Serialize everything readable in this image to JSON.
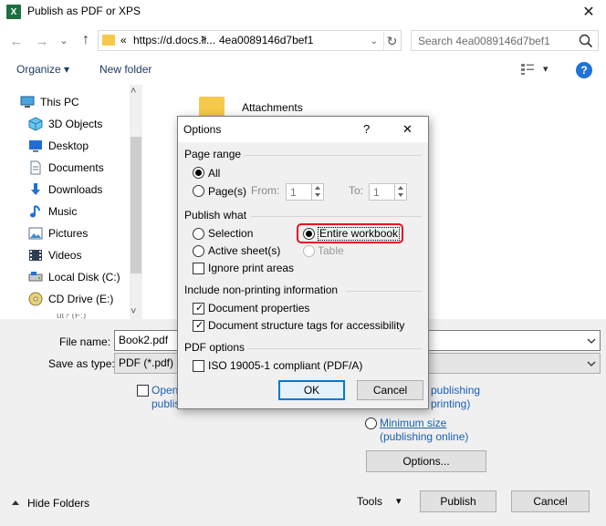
{
  "window": {
    "title": "Publish as PDF or XPS",
    "app_icon_letter": "X",
    "close_glyph": "✕"
  },
  "address": {
    "back_glyph": "←",
    "forward_glyph": "→",
    "history_glyph": "⌄",
    "up_glyph": "↑",
    "prefix": "«",
    "path": "https://d.docs.li...",
    "sep": ">",
    "crumb": "4ea0089146d7bef1",
    "dropdown_glyph": "⌄",
    "refresh_glyph": "↻"
  },
  "search": {
    "placeholder": "Search 4ea0089146d7bef1"
  },
  "toolbar": {
    "organize_label": "Organize ▾",
    "new_folder_label": "New folder",
    "view_dd_glyph": "▾",
    "help_label": "?"
  },
  "sidebar": {
    "items": [
      {
        "label": "This PC",
        "icon": "computer-icon"
      },
      {
        "label": "3D Objects",
        "icon": "cube-icon"
      },
      {
        "label": "Desktop",
        "icon": "desktop-icon"
      },
      {
        "label": "Documents",
        "icon": "document-icon"
      },
      {
        "label": "Downloads",
        "icon": "download-icon"
      },
      {
        "label": "Music",
        "icon": "music-icon"
      },
      {
        "label": "Pictures",
        "icon": "picture-icon"
      },
      {
        "label": "Videos",
        "icon": "video-icon"
      },
      {
        "label": "Local Disk (C:)",
        "icon": "drive-icon"
      },
      {
        "label": "CD Drive (E:)",
        "icon": "cd-icon"
      }
    ],
    "scroll_up": "˄",
    "scroll_down": "˅",
    "cut_item": "ut? (F:)"
  },
  "files": {
    "items": [
      {
        "label": "Attachments",
        "icon": "folder-icon"
      }
    ]
  },
  "form": {
    "file_name_label": "File name:",
    "file_name_value": "Book2.pdf",
    "save_type_label": "Save as type:",
    "save_type_value": "PDF (*.pdf)",
    "open_label_1": "Open",
    "open_label_2": "publis",
    "opt_std_1": "publishing",
    "opt_std_2": "printing)",
    "min_size_1": "Minimum size",
    "min_size_2": "(publishing online)",
    "options_button": "Options...",
    "hide_folders": "Hide Folders",
    "tools_label": "Tools",
    "tools_dd": "▾",
    "publish_button": "Publish",
    "cancel_button": "Cancel"
  },
  "dialog": {
    "title": "Options",
    "help_glyph": "?",
    "close_glyph": "✕",
    "page_range": {
      "heading": "Page range",
      "all_label": "All",
      "pages_label": "Page(s)",
      "from_label": "From:",
      "from_value": "1",
      "to_label": "To:",
      "to_value": "1"
    },
    "publish_what": {
      "heading": "Publish what",
      "selection_label": "Selection",
      "entire_workbook_label": "Entire workbook",
      "active_sheets_label": "Active sheet(s)",
      "table_label": "Table",
      "ignore_print_areas_label": "Ignore print areas"
    },
    "non_printing": {
      "heading": "Include non-printing information",
      "doc_props_label": "Document properties",
      "doc_tags_label": "Document structure tags for accessibility"
    },
    "pdf_options": {
      "heading": "PDF options",
      "iso_label": "ISO 19005-1 compliant (PDF/A)"
    },
    "ok_button": "OK",
    "cancel_button": "Cancel",
    "highlight_color": "#e81123"
  }
}
